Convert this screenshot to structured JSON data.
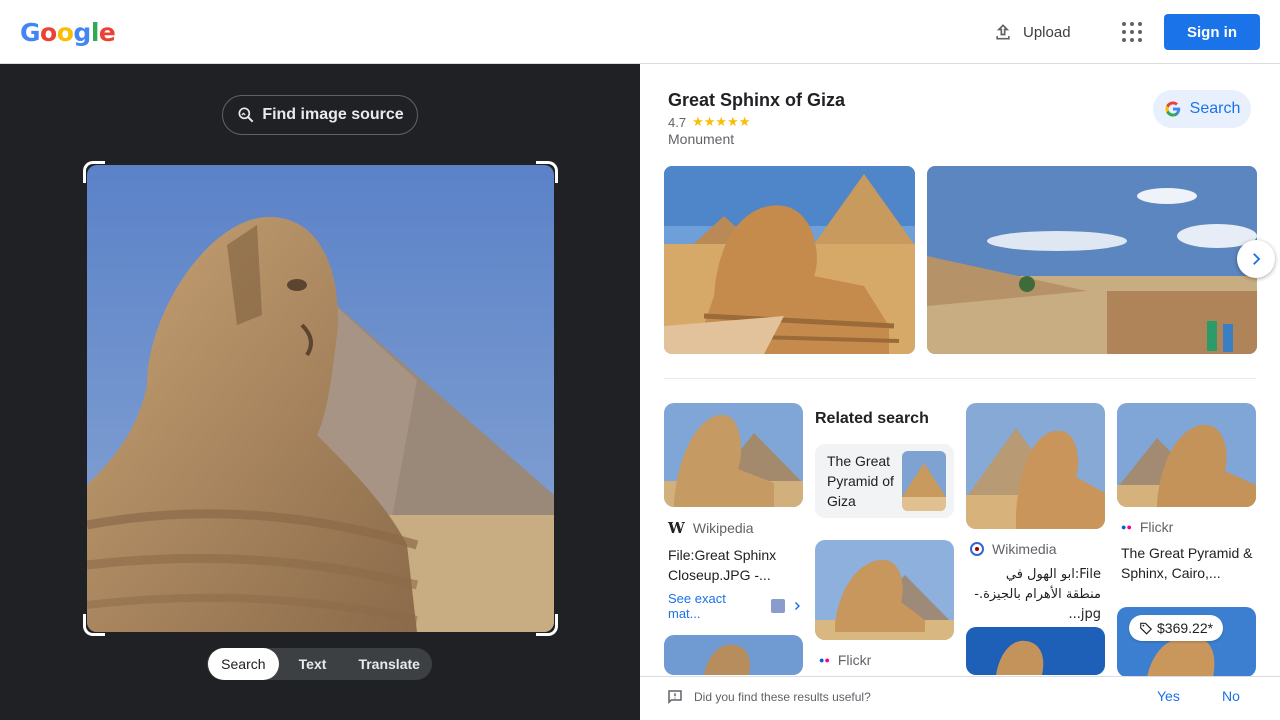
{
  "header": {
    "logo": [
      "G",
      "o",
      "o",
      "g",
      "l",
      "e"
    ],
    "logo_colors": [
      "#4285f4",
      "#ea4335",
      "#fbbc05",
      "#4285f4",
      "#34a853",
      "#ea4335"
    ],
    "upload_label": "Upload",
    "signin_label": "Sign in"
  },
  "lens": {
    "find_source_label": "Find image source",
    "modes": [
      "Search",
      "Text",
      "Translate"
    ],
    "active_mode": "Search"
  },
  "knowledge": {
    "title": "Great Sphinx of Giza",
    "rating": "4.7",
    "stars": "★★★★★",
    "type": "Monument",
    "search_label": "Search"
  },
  "results": {
    "card1": {
      "source": "Wikipedia",
      "title": "File:Great Sphinx Closeup.JPG -...",
      "see_exact": "See exact mat..."
    },
    "related_heading": "Related search",
    "related": {
      "label": "The Great Pyramid of Giza"
    },
    "card2": {
      "source": "Flickr"
    },
    "card3": {
      "source": "Wikimedia",
      "title": "File:ابو الهول في منطقة الأهرام بالجيزة.-jpg..."
    },
    "card4": {
      "source": "Flickr",
      "title": "The Great Pyramid & Sphinx, Cairo,..."
    },
    "card5": {
      "price": "$369.22*"
    }
  },
  "feedback": {
    "question": "Did you find these results useful?",
    "yes": "Yes",
    "no": "No"
  },
  "colors": {
    "accent": "#1a73e8",
    "panel_dark": "#202124",
    "star": "#fbbc04"
  }
}
